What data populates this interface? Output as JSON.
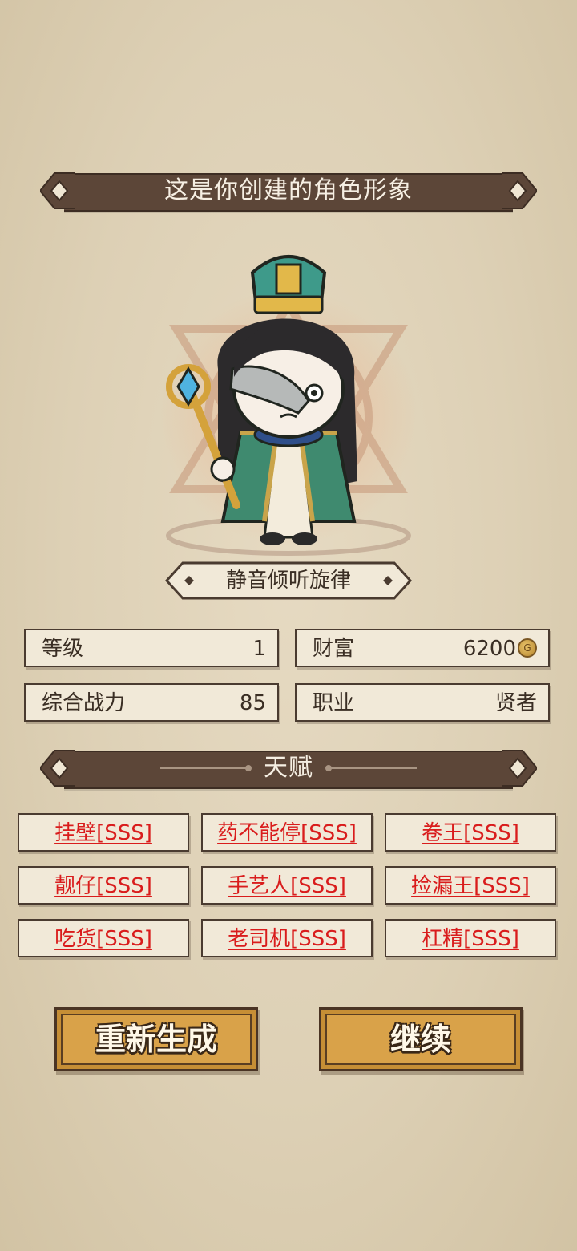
{
  "header": {
    "title": "这是你创建的角色形象"
  },
  "character": {
    "name": "静音倾听旋律"
  },
  "stats": {
    "level_label": "等级",
    "level_value": "1",
    "wealth_label": "财富",
    "wealth_value": "6200",
    "power_label": "综合战力",
    "power_value": "85",
    "job_label": "职业",
    "job_value": "贤者"
  },
  "talents_header": {
    "title": "天赋"
  },
  "talents": [
    "挂壁[SSS]",
    "药不能停[SSS]",
    "卷王[SSS]",
    "靓仔[SSS]",
    "手艺人[SSS]",
    "捡漏王[SSS]",
    "吃货[SSS]",
    "老司机[SSS]",
    "杠精[SSS]"
  ],
  "buttons": {
    "regenerate": "重新生成",
    "continue": "继续"
  },
  "colors": {
    "banner": "#5c4638",
    "button": "#d9a249",
    "talent_text": "#d91c1c"
  }
}
